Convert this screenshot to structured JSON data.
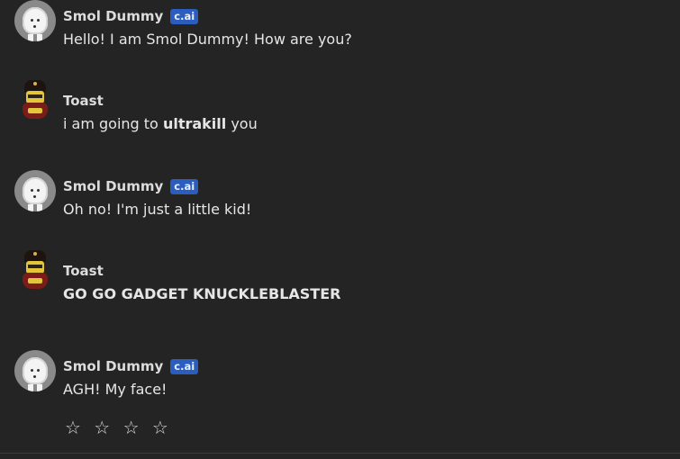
{
  "messages": [
    {
      "author": "Smol Dummy",
      "badge": "c.ai",
      "text": "Hello! I am Smol Dummy! How are you?"
    },
    {
      "author": "Toast",
      "text_before": "i am going to ",
      "text_bold": "ultrakill",
      "text_after": " you"
    },
    {
      "author": "Smol Dummy",
      "badge": "c.ai",
      "text": "Oh no! I'm just a little kid!"
    },
    {
      "author": "Toast",
      "text": "GO GO GADGET KNUCKLEBLASTER"
    },
    {
      "author": "Smol Dummy",
      "badge": "c.ai",
      "text": "AGH! My face!"
    }
  ],
  "rating": {
    "stars": [
      "☆",
      "☆",
      "☆",
      "☆"
    ],
    "value": 0,
    "max": 4
  },
  "colors": {
    "background": "#242424",
    "badge": "#2a5dbd",
    "text": "#e6e6e6"
  },
  "icons": {
    "bot_avatar": "smol-dummy-avatar",
    "user_avatar": "toast-avatar"
  }
}
